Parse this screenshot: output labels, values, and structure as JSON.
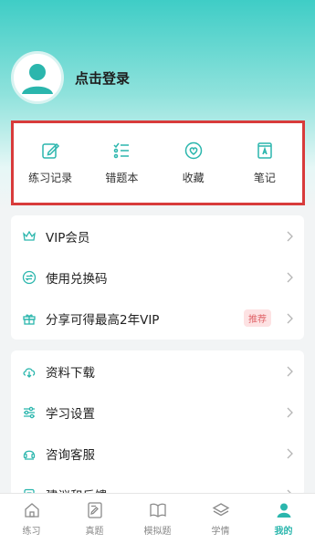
{
  "profile": {
    "login_label": "点击登录"
  },
  "quick_actions": [
    {
      "label": "练习记录",
      "icon": "edit-icon"
    },
    {
      "label": "错题本",
      "icon": "list-check-icon"
    },
    {
      "label": "收藏",
      "icon": "heart-icon"
    },
    {
      "label": "笔记",
      "icon": "notebook-icon"
    }
  ],
  "menu_group1": [
    {
      "label": "VIP会员",
      "icon": "crown-icon"
    },
    {
      "label": "使用兑换码",
      "icon": "exchange-icon"
    },
    {
      "label": "分享可得最高2年VIP",
      "icon": "gift-icon",
      "badge": "推荐"
    }
  ],
  "menu_group2": [
    {
      "label": "资料下载",
      "icon": "download-cloud-icon"
    },
    {
      "label": "学习设置",
      "icon": "sliders-icon"
    },
    {
      "label": "咨询客服",
      "icon": "headset-icon"
    },
    {
      "label": "建议和反馈",
      "icon": "feedback-icon"
    }
  ],
  "tabbar": [
    {
      "label": "练习",
      "icon": "home-icon",
      "active": false
    },
    {
      "label": "真题",
      "icon": "exam-paper-icon",
      "active": false
    },
    {
      "label": "模拟题",
      "icon": "book-open-icon",
      "active": false
    },
    {
      "label": "学情",
      "icon": "layers-icon",
      "active": false
    },
    {
      "label": "我的",
      "icon": "user-icon",
      "active": true
    }
  ],
  "colors": {
    "accent": "#2bb6ad",
    "highlight_outline": "#d83b3b",
    "badge_text": "#e0656a",
    "badge_bg": "#fde2e3"
  }
}
